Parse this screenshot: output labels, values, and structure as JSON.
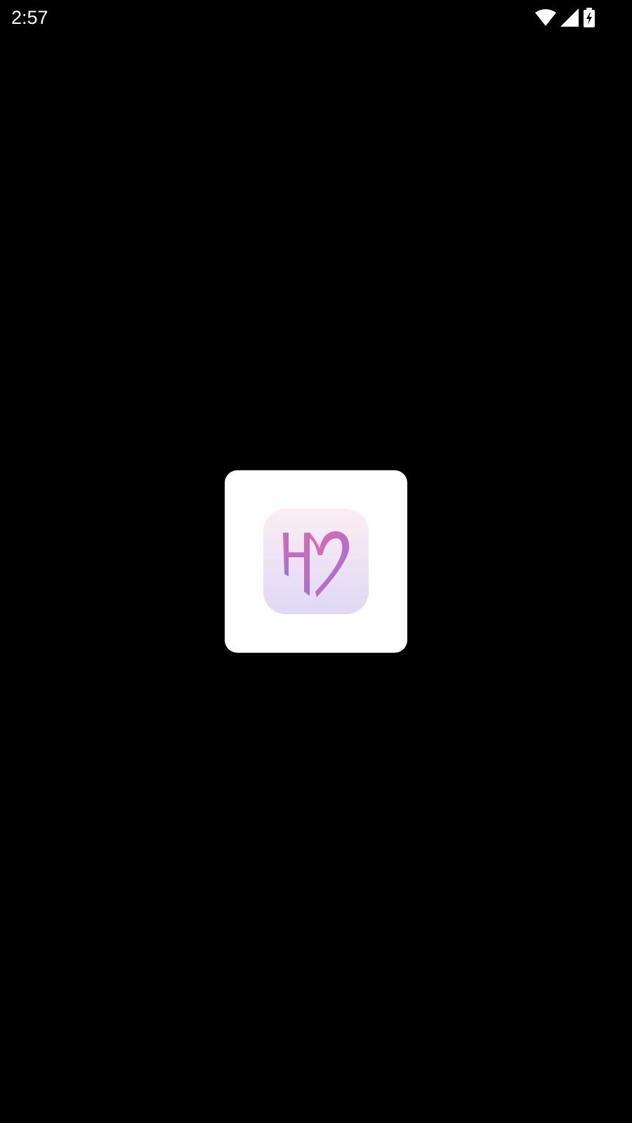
{
  "status_bar": {
    "time": "2:57",
    "icons": [
      "wifi-icon",
      "cellular-signal-icon",
      "battery-charging-icon"
    ]
  },
  "splash": {
    "logo_icon": "app-logo-hm-heart-icon",
    "colors": {
      "card_background": "#ffffff",
      "logo_background_top": "#fbeef4",
      "logo_background_bottom": "#e0d8f5",
      "logo_pink": "#e06aa8",
      "logo_purple": "#9a72e0"
    }
  }
}
